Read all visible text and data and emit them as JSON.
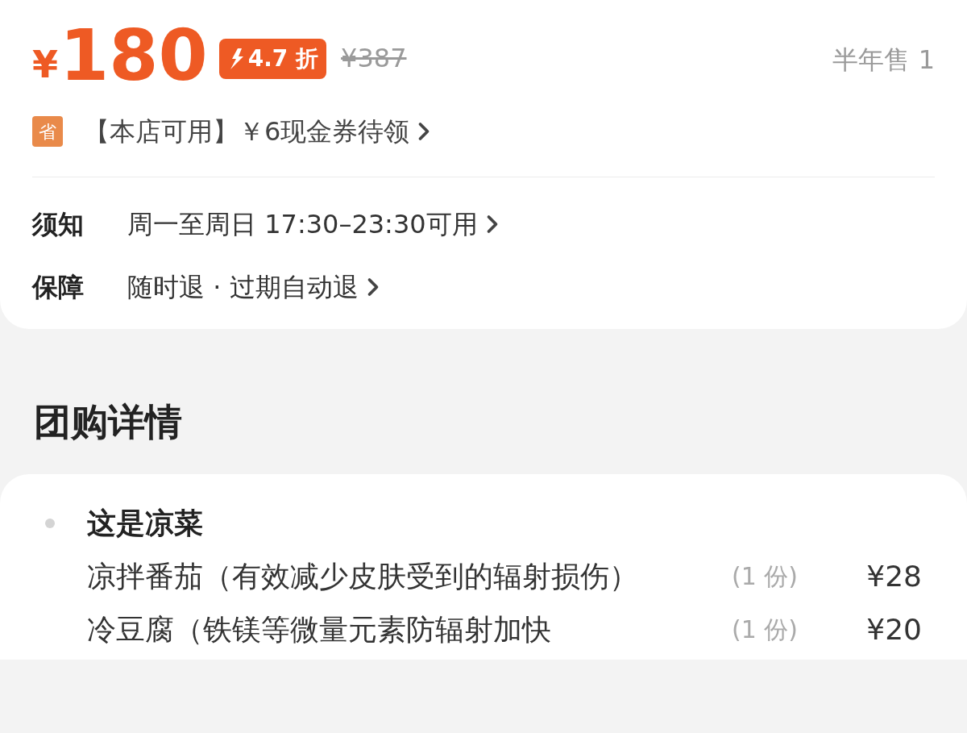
{
  "price": {
    "currency": "¥",
    "amount": "180",
    "discount": "4.7 折",
    "original": "¥387",
    "sales": "半年售 1"
  },
  "coupon": {
    "icon": "省",
    "text": "【本店可用】￥6现金券待领"
  },
  "info_rows": [
    {
      "label": "须知",
      "value": "周一至周日 17:30–23:30可用"
    },
    {
      "label": "保障",
      "value": "随时退 · 过期自动退"
    }
  ],
  "section_title": "团购详情",
  "groups": [
    {
      "title": "这是凉菜",
      "items": [
        {
          "name": "凉拌番茄（有效减少皮肤受到的辐射损伤）",
          "qty": "(1 份)",
          "price": "¥28"
        },
        {
          "name": "冷豆腐（铁镁等微量元素防辐射加快",
          "qty": "(1 份)",
          "price": "¥20"
        }
      ]
    }
  ]
}
